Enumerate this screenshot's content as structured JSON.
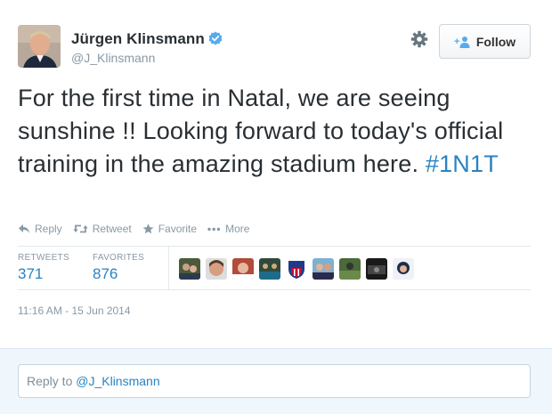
{
  "author": {
    "name": "Jürgen Klinsmann",
    "handle": "@J_Klinsmann",
    "verified": true
  },
  "follow_button": {
    "label": "Follow",
    "icon": "add-user-icon"
  },
  "settings_icon": "gear-icon",
  "tweet": {
    "text": "For the first time in Natal, we are seeing sunshine !! Looking forward to today's official training in the amazing stadium here. ",
    "hashtag": "#1N1T"
  },
  "actions": [
    {
      "label": "Reply",
      "icon": "reply-icon"
    },
    {
      "label": "Retweet",
      "icon": "retweet-icon"
    },
    {
      "label": "Favorite",
      "icon": "star-icon"
    },
    {
      "label": "More",
      "icon": "more-dots-icon"
    }
  ],
  "stats": {
    "retweets_label": "RETWEETS",
    "retweets_count": "371",
    "favorites_label": "FAVORITES",
    "favorites_count": "876"
  },
  "timestamp": "11:16 AM - 15 Jun 2014",
  "reply": {
    "prefix": "Reply to ",
    "mention": "@J_Klinsmann"
  },
  "colors": {
    "link": "#2a83c1",
    "muted": "#8899a6",
    "text": "#292f33",
    "reply_bg": "#eff7fc"
  }
}
